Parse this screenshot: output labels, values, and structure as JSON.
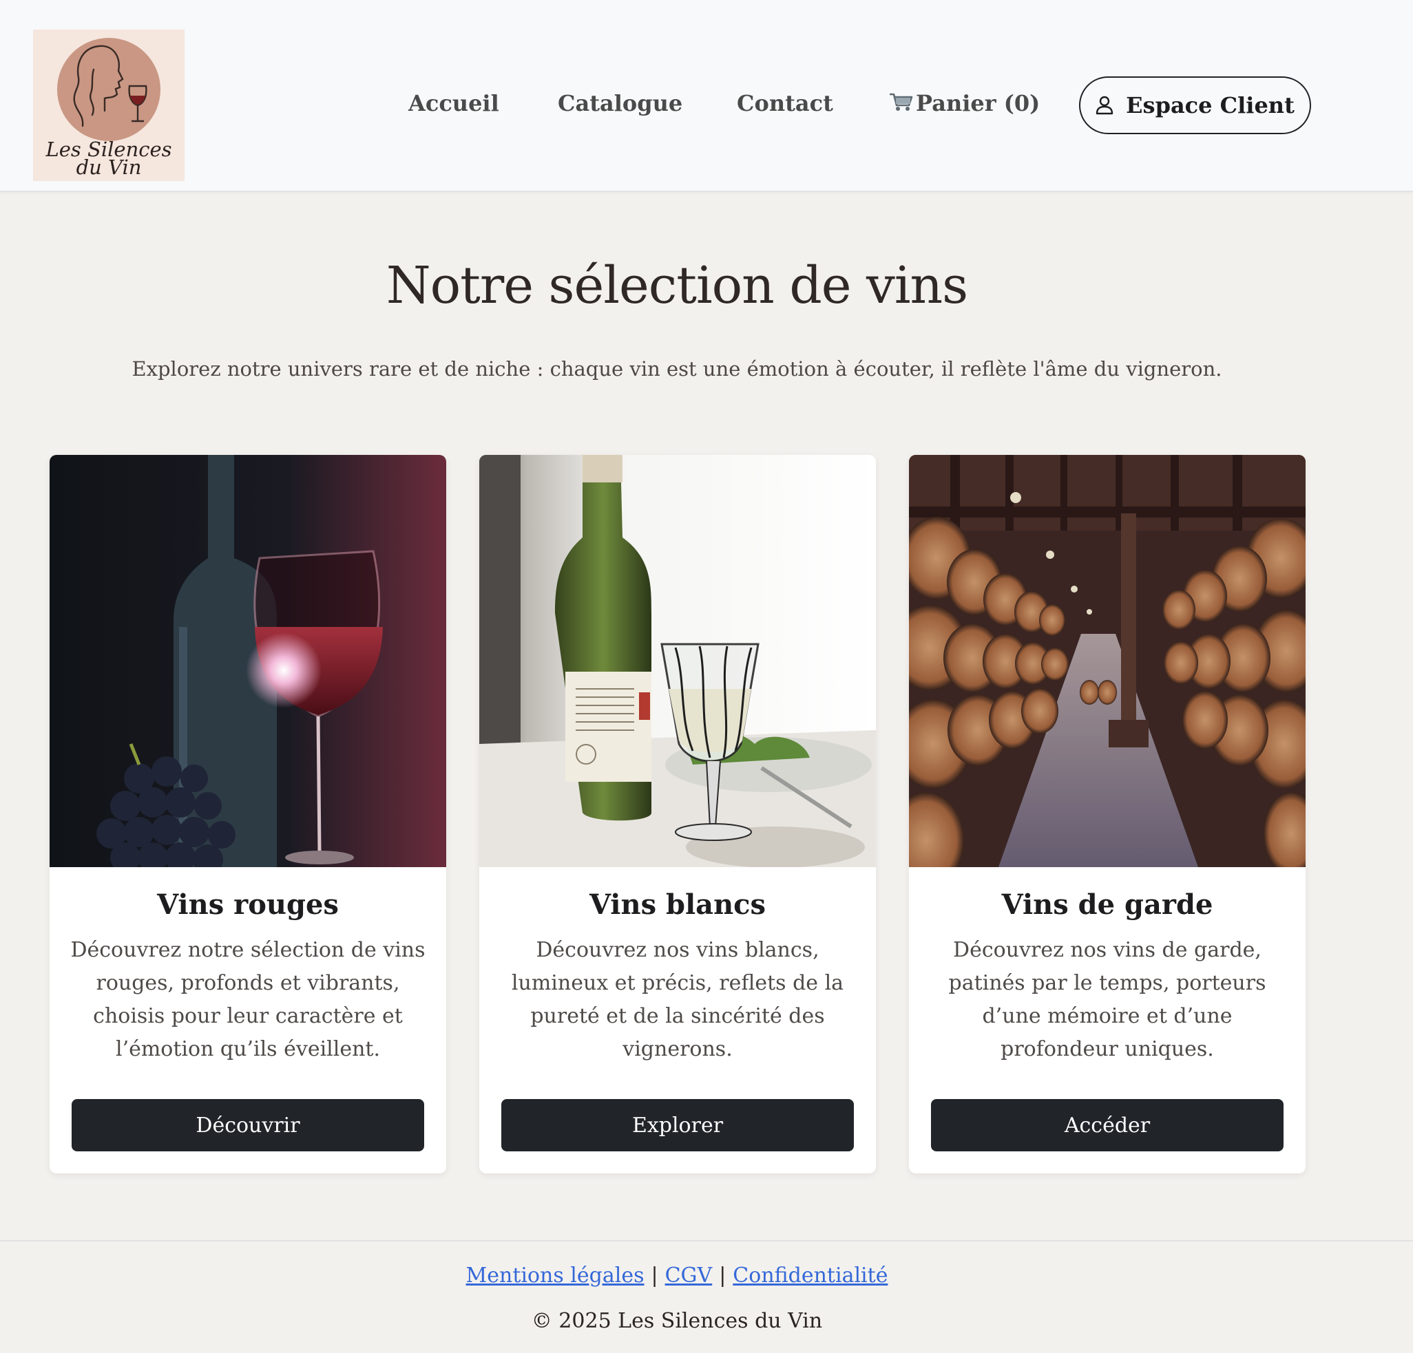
{
  "brand": {
    "logo_line1": "Les Silences",
    "logo_line2": "du Vin"
  },
  "nav": {
    "home": "Accueil",
    "catalog": "Catalogue",
    "contact": "Contact",
    "cart": "Panier (0)",
    "client_button": "Espace Client"
  },
  "hero": {
    "title": "Notre sélection de vins",
    "subtitle": "Explorez notre univers rare et de niche : chaque vin est une émotion à écouter, il reflète l'âme du vigneron."
  },
  "cards": [
    {
      "title": "Vins rouges",
      "text": "Découvrez notre sélection de vins rouges, profonds et vibrants, choisis pour leur caractère et l’émotion qu’ils éveillent.",
      "button": "Découvrir"
    },
    {
      "title": "Vins blancs",
      "text": "Découvrez nos vins blancs, lumineux et précis, reflets de la pureté et de la sincérité des vignerons.",
      "button": "Explorer"
    },
    {
      "title": "Vins de garde",
      "text": "Découvrez nos vins de garde, patinés par le temps, porteurs d’une mémoire et d’une profondeur uniques.",
      "button": "Accéder"
    }
  ],
  "footer": {
    "legal": "Mentions légales",
    "cgv": "CGV",
    "privacy": "Confidentialité",
    "separator": "|",
    "copyright": "© 2025 Les Silences du Vin"
  },
  "icons": {
    "cart": "shopping-cart-icon",
    "client": "user-icon"
  },
  "colors": {
    "page_background": "#f3f1ee",
    "header_background": "#f8f9fa",
    "button_dark": "#212529",
    "link_blue": "#3468d8",
    "logo_background": "#f5e6de",
    "logo_circle": "#c99783"
  }
}
